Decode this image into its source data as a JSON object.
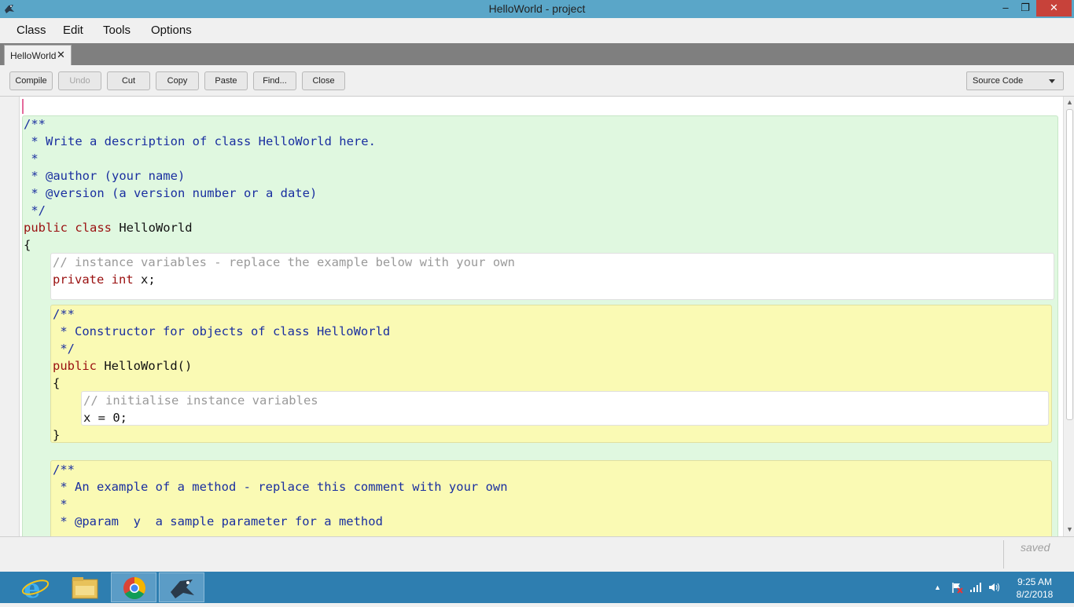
{
  "window": {
    "title": "HelloWorld - project",
    "min": "–",
    "max": "❐",
    "close": "✕"
  },
  "menu": [
    "Class",
    "Edit",
    "Tools",
    "Options"
  ],
  "tab": {
    "label": "HelloWorld",
    "close": "✕"
  },
  "toolbar": {
    "compile": "Compile",
    "undo": "Undo",
    "cut": "Cut",
    "copy": "Copy",
    "paste": "Paste",
    "find": "Find...",
    "close": "Close",
    "view_select": "Source Code"
  },
  "code": {
    "l1": "/**",
    "l2": " * Write a description of class HelloWorld here.",
    "l3": " *",
    "l4": " * @author (your name)",
    "l5": " * @version (a version number or a date)",
    "l6": " */",
    "l7_kw": "public class",
    "l7_name": " HelloWorld",
    "l8": "{",
    "l9": "// instance variables - replace the example below with your own",
    "l10_kw": "private int",
    "l10_rest": " x;",
    "l11": "/**",
    "l12": " * Constructor for objects of class HelloWorld",
    "l13": " */",
    "l14_kw": "public",
    "l14_rest": " HelloWorld()",
    "l15": "{",
    "l16": "// initialise instance variables",
    "l17": "x = 0;",
    "l18": "}",
    "l19": "/**",
    "l20": " * An example of a method - replace this comment with your own",
    "l21": " *",
    "l22": " * @param  y  a sample parameter for a method"
  },
  "status": "saved",
  "tray": {
    "time": "9:25 AM",
    "date": "8/2/2018"
  },
  "taskbar_apps": [
    "internet-explorer",
    "file-explorer",
    "chrome",
    "bluej"
  ]
}
